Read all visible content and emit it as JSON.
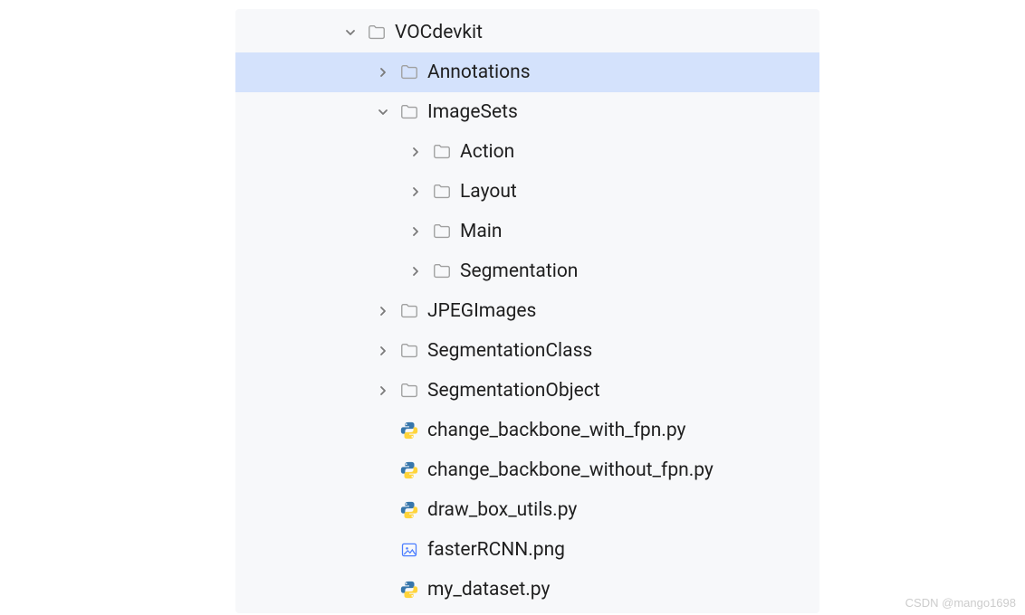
{
  "tree": {
    "root": {
      "label": "VOCdevkit",
      "expanded": true
    },
    "annotations": {
      "label": "Annotations",
      "expanded": false,
      "selected": true
    },
    "imagesets": {
      "label": "ImageSets",
      "expanded": true
    },
    "action": {
      "label": "Action",
      "expanded": false
    },
    "layout": {
      "label": "Layout",
      "expanded": false
    },
    "main": {
      "label": "Main",
      "expanded": false
    },
    "segmentation": {
      "label": "Segmentation",
      "expanded": false
    },
    "jpegimages": {
      "label": "JPEGImages",
      "expanded": false
    },
    "segmentationclass": {
      "label": "SegmentationClass",
      "expanded": false
    },
    "segmentationobject": {
      "label": "SegmentationObject",
      "expanded": false
    },
    "file1": {
      "label": "change_backbone_with_fpn.py"
    },
    "file2": {
      "label": "change_backbone_without_fpn.py"
    },
    "file3": {
      "label": "draw_box_utils.py"
    },
    "file4": {
      "label": "fasterRCNN.png"
    },
    "file5": {
      "label": "my_dataset.py"
    }
  },
  "watermark": "CSDN @mango1698"
}
